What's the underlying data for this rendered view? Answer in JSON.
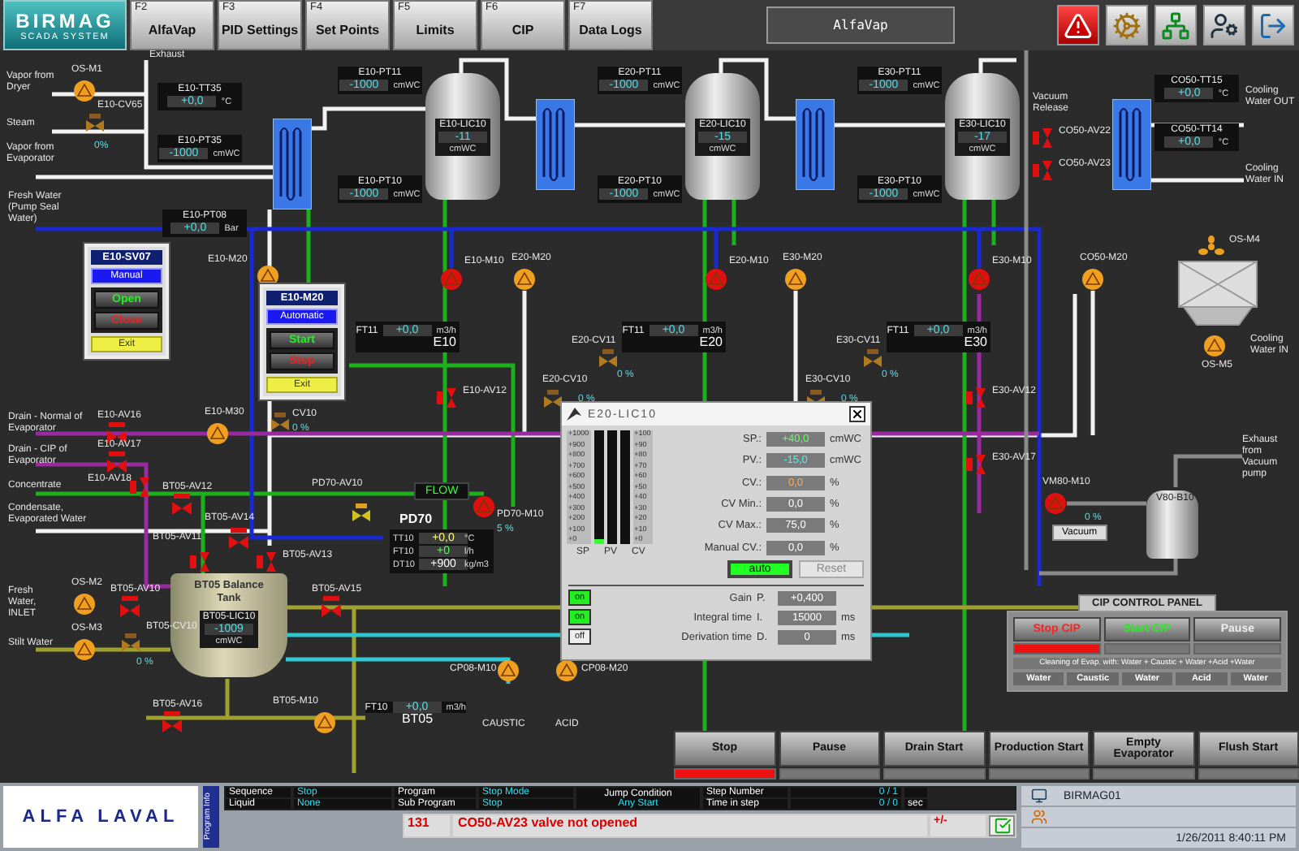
{
  "header": {
    "logo": "BIRMAG",
    "subtitle": "SCADA SYSTEM",
    "screen_title": "AlfaVap",
    "keys": [
      {
        "key": "F2",
        "label": "AlfaVap",
        "selected": false
      },
      {
        "key": "F3",
        "label": "PID Settings",
        "selected": false
      },
      {
        "key": "F4",
        "label": "Set Points",
        "selected": false
      },
      {
        "key": "F5",
        "label": "Limits",
        "selected": false
      },
      {
        "key": "F6",
        "label": "CIP",
        "selected": false
      },
      {
        "key": "F7",
        "label": "Data Logs",
        "selected": false
      }
    ]
  },
  "canvas": {
    "readouts": [
      {
        "tag": "E10-TT35",
        "value": "+0,0",
        "unit": "°C"
      },
      {
        "tag": "E10-PT35",
        "value": "-1000",
        "unit": "cmWC"
      },
      {
        "tag": "E10-PT11",
        "value": "-1000",
        "unit": "cmWC"
      },
      {
        "tag": "E10-PT10",
        "value": "-1000",
        "unit": "cmWC"
      },
      {
        "tag": "E20-PT11",
        "value": "-1000",
        "unit": "cmWC"
      },
      {
        "tag": "E20-PT10",
        "value": "-1000",
        "unit": "cmWC"
      },
      {
        "tag": "E30-PT11",
        "value": "-1000",
        "unit": "cmWC"
      },
      {
        "tag": "E30-PT10",
        "value": "-1000",
        "unit": "cmWC"
      },
      {
        "tag": "CO50-TT15",
        "value": "+0,0",
        "unit": "°C"
      },
      {
        "tag": "CO50-TT14",
        "value": "+0,0",
        "unit": "°C"
      },
      {
        "tag": "E10-PT08",
        "value": "+0,0",
        "unit": "Bar"
      }
    ],
    "vessels": [
      {
        "tag": "E10-LIC10",
        "value": "-11",
        "unit": "cmWC"
      },
      {
        "tag": "E20-LIC10",
        "value": "-15",
        "unit": "cmWC"
      },
      {
        "tag": "E30-LIC10",
        "value": "-17",
        "unit": "cmWC"
      }
    ],
    "balance_tank": {
      "name": "BT05 Balance Tank",
      "tag": "BT05-LIC10",
      "value": "-1009",
      "unit": "cmWC"
    },
    "flow_panels": [
      {
        "tag": "FT11",
        "value": "+0,0",
        "unit": "m3/h",
        "unit_name": "E10"
      },
      {
        "tag": "FT11",
        "value": "+0,0",
        "unit": "m3/h",
        "unit_name": "E20"
      },
      {
        "tag": "FT11",
        "value": "+0,0",
        "unit": "m3/h",
        "unit_name": "E30"
      },
      {
        "tag": "FT10",
        "value": "+0,0",
        "unit": "m3/h",
        "unit_name": "BT05"
      }
    ],
    "pd70": {
      "title": "PD70",
      "flow_label": "FLOW",
      "rows": [
        {
          "tag": "TT10",
          "value": "+0,0",
          "unit": "°C",
          "kind": "temp"
        },
        {
          "tag": "FT10",
          "value": "+0",
          "unit": "l/h",
          "kind": "flow"
        },
        {
          "tag": "DT10",
          "value": "+900",
          "unit": "kg/m3",
          "kind": "density"
        }
      ]
    },
    "pumps": [
      {
        "tag": "OS-M1",
        "running": false
      },
      {
        "tag": "E10-M20",
        "running": false
      },
      {
        "tag": "E10-M10",
        "running": true
      },
      {
        "tag": "E20-M20",
        "running": false
      },
      {
        "tag": "E20-M10",
        "running": true
      },
      {
        "tag": "E30-M20",
        "running": false
      },
      {
        "tag": "E30-M10",
        "running": true
      },
      {
        "tag": "CO50-M20",
        "running": false
      },
      {
        "tag": "OS-M5",
        "running": false
      },
      {
        "tag": "E10-M30",
        "running": false
      },
      {
        "tag": "PD70-M10",
        "running": true
      },
      {
        "tag": "OS-M2",
        "running": false
      },
      {
        "tag": "OS-M3",
        "running": false
      },
      {
        "tag": "CP08-M10",
        "running": false
      },
      {
        "tag": "CP08-M20",
        "running": false
      },
      {
        "tag": "BT05-M10",
        "running": false
      },
      {
        "tag": "VM80-M10",
        "running": true
      }
    ],
    "valves": [
      "E10-AV16",
      "E10-AV17",
      "E10-AV18",
      "BT05-AV12",
      "BT05-AV14",
      "BT05-AV11",
      "BT05-AV13",
      "BT05-AV10",
      "BT05-AV15",
      "BT05-AV16",
      "E10-AV12",
      "E30-AV12",
      "E30-AV17",
      "CO50-AV22",
      "CO50-AV23"
    ],
    "control_valves": [
      {
        "tag": "E10-CV65",
        "reading": "0%"
      },
      {
        "tag": "CV10",
        "reading": "0 %"
      },
      {
        "tag": "E20-CV11",
        "reading": "0 %"
      },
      {
        "tag": "E20-CV10",
        "reading": "0 %"
      },
      {
        "tag": "E30-CV11",
        "reading": "0 %"
      },
      {
        "tag": "E30-CV10",
        "reading": "0 %"
      },
      {
        "tag": "BT05-CV10",
        "reading": "0 %"
      },
      {
        "tag": "PD70-AV10"
      }
    ],
    "labels": [
      "Exhaust",
      "Vapor from Dryer",
      "Steam",
      "Vapor from Evaporator",
      "Vacuum Release",
      "Cooling Water OUT",
      "Cooling Water IN",
      "Fresh Water (Pump Seal Water)",
      "Drain - Normal of Evaporator",
      "Drain - CIP of Evaporator",
      "Concentrate",
      "Condensate, Evaporated Water",
      "Fresh Water, INLET",
      "Stilt Water",
      "OS-M4",
      "Cooling Water IN",
      "Exhaust from Vacuum pump",
      "CAUSTIC",
      "ACID",
      "5 %",
      "0 %",
      "V80-B10"
    ],
    "vacuum_button": "Vacuum",
    "manual_popups": [
      {
        "title": "E10-SV07",
        "mode": "Manual",
        "buttons": [
          "Open",
          "Close"
        ],
        "exit": "Exit"
      },
      {
        "title": "E10-M20",
        "mode": "Automatic",
        "buttons": [
          "Start",
          "Stop"
        ],
        "exit": "Exit"
      }
    ]
  },
  "pid_popup": {
    "title": "E20-LIC10",
    "scale_left": [
      "+1000",
      "+900",
      "+800",
      "+700",
      "+600",
      "+500",
      "+400",
      "+300",
      "+200",
      "+100",
      "+0"
    ],
    "scale_right": [
      "+100",
      "+90",
      "+80",
      "+70",
      "+60",
      "+50",
      "+40",
      "+30",
      "+20",
      "+10",
      "+0"
    ],
    "bars": [
      {
        "label": "SP",
        "level": 0.04
      },
      {
        "label": "PV"
      },
      {
        "label": "CV"
      }
    ],
    "params": [
      {
        "label": "SP.:",
        "value": "+40,0",
        "unit": "cmWC",
        "kind": "setpoint"
      },
      {
        "label": "PV.:",
        "value": "-15,0",
        "unit": "cmWC",
        "kind": "process"
      },
      {
        "label": "CV.:",
        "value": "0,0",
        "unit": "%",
        "kind": "output"
      },
      {
        "label": "CV Min.:",
        "value": "0,0",
        "unit": "%",
        "kind": "limit"
      },
      {
        "label": "CV Max.:",
        "value": "75,0",
        "unit": "%",
        "kind": "limit"
      },
      {
        "label": "Manual CV.:",
        "value": "0,0",
        "unit": "%",
        "kind": "limit"
      }
    ],
    "mode_button": "auto",
    "reset_button": {
      "label": "Reset",
      "disabled": true
    },
    "tuning": [
      {
        "toggle": "on",
        "on": true,
        "label": "Gain",
        "symbol": "P.",
        "value": "+0,400"
      },
      {
        "toggle": "on",
        "on": true,
        "label": "Integral time",
        "symbol": "I.",
        "value": "15000",
        "unit": "ms"
      },
      {
        "toggle": "off",
        "on": false,
        "label": "Derivation time",
        "symbol": "D.",
        "value": "0",
        "unit": "ms"
      }
    ]
  },
  "cip_panel": {
    "title": "CIP CONTROL PANEL",
    "buttons": [
      {
        "label": "Stop CIP",
        "kind": "stop",
        "active": true
      },
      {
        "label": "Start CIP",
        "kind": "start",
        "active": false
      },
      {
        "label": "Pause",
        "kind": "pause",
        "active": false
      }
    ],
    "description": "Cleaning of Evap. with: Water + Caustic + Water +Acid +Water",
    "steps": [
      "Water",
      "Caustic",
      "Water",
      "Acid",
      "Water"
    ]
  },
  "control_buttons": [
    {
      "label": "Stop",
      "active": true
    },
    {
      "label": "Pause",
      "active": false
    },
    {
      "label": "Drain Start",
      "active": false
    },
    {
      "label": "Production Start",
      "active": false
    },
    {
      "label": "Empty Evaporator",
      "active": false
    },
    {
      "label": "Flush Start",
      "active": false
    }
  ],
  "status_bar": {
    "logo": "ALFA LAVAL",
    "side_label": "Program Info",
    "fields": [
      {
        "label": "Sequence",
        "value": "Stop"
      },
      {
        "label": "Program",
        "value": "Stop Mode"
      },
      {
        "label": "Liquid",
        "value": "None"
      },
      {
        "label": "Sub Program",
        "value": "Stop"
      }
    ],
    "jump": {
      "label": "Jump Condition",
      "value": "Any Start"
    },
    "steps": [
      {
        "label": "Step Number",
        "value": "0 / 1"
      },
      {
        "label": "Time in step",
        "value": "0 / 0",
        "unit": "sec"
      }
    ],
    "alarm": {
      "code": "131",
      "message": "CO50-AV23 valve not opened",
      "sign": "+/-"
    },
    "station": "BIRMAG01",
    "datetime": "1/26/2011 8:40:11 PM"
  }
}
